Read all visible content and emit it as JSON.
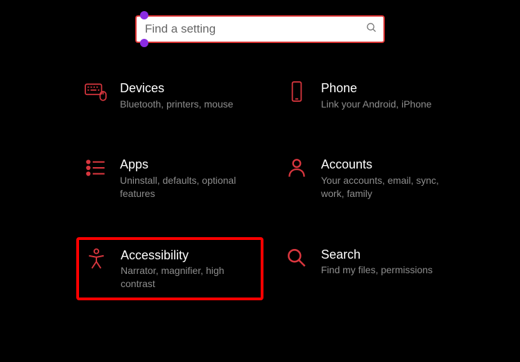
{
  "search": {
    "placeholder": "Find a setting"
  },
  "categories": [
    {
      "id": "devices",
      "title": "Devices",
      "desc": "Bluetooth, printers, mouse",
      "icon": "keyboard-mouse-icon",
      "highlight": false
    },
    {
      "id": "phone",
      "title": "Phone",
      "desc": "Link your Android, iPhone",
      "icon": "phone-icon",
      "highlight": false
    },
    {
      "id": "apps",
      "title": "Apps",
      "desc": "Uninstall, defaults, optional features",
      "icon": "list-icon",
      "highlight": false
    },
    {
      "id": "accounts",
      "title": "Accounts",
      "desc": "Your accounts, email, sync, work, family",
      "icon": "person-icon",
      "highlight": false
    },
    {
      "id": "accessibility",
      "title": "Accessibility",
      "desc": "Narrator, magnifier, high contrast",
      "icon": "accessibility-icon",
      "highlight": true
    },
    {
      "id": "search",
      "title": "Search",
      "desc": "Find my files, permissions",
      "icon": "magnify-icon",
      "highlight": false
    }
  ]
}
